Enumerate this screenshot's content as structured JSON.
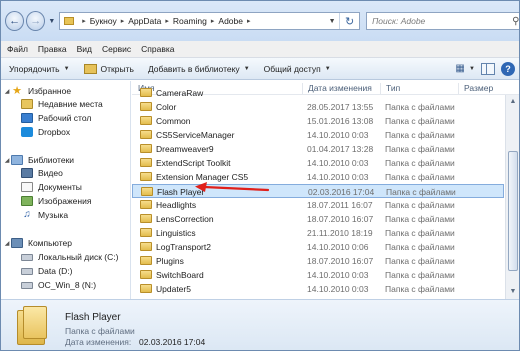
{
  "address": {
    "breadcrumbs": [
      "Букноу",
      "AppData",
      "Roaming",
      "Adobe"
    ]
  },
  "search": {
    "placeholder": "Поиск: Adobe"
  },
  "menu": [
    "Файл",
    "Правка",
    "Вид",
    "Сервис",
    "Справка"
  ],
  "toolbar": {
    "organize": "Упорядочить",
    "open": "Открыть",
    "add_to_library": "Добавить в библиотеку",
    "share": "Общий доступ"
  },
  "columns": {
    "name": "Имя",
    "date": "Дата изменения",
    "type": "Тип",
    "size": "Размер"
  },
  "nav": {
    "favorites": "Избранное",
    "recent": "Недавние места",
    "desktop": "Рабочий стол",
    "dropbox": "Dropbox",
    "libraries": "Библиотеки",
    "video": "Видео",
    "documents": "Документы",
    "images": "Изображения",
    "music": "Музыка",
    "computer": "Компьютер",
    "local_disk": "Локальный диск (C:)",
    "data_disk": "Data (D:)",
    "oc_win": "OC_Win_8 (N:)"
  },
  "files": [
    {
      "name": "CameraRaw",
      "date": "",
      "type": ""
    },
    {
      "name": "Color",
      "date": "28.05.2017 13:55",
      "type": "Папка с файлами"
    },
    {
      "name": "Common",
      "date": "15.01.2016 13:08",
      "type": "Папка с файлами"
    },
    {
      "name": "CS5ServiceManager",
      "date": "14.10.2010 0:03",
      "type": "Папка с файлами"
    },
    {
      "name": "Dreamweaver9",
      "date": "01.04.2017 13:28",
      "type": "Папка с файлами"
    },
    {
      "name": "ExtendScript Toolkit",
      "date": "14.10.2010 0:03",
      "type": "Папка с файлами"
    },
    {
      "name": "Extension Manager CS5",
      "date": "14.10.2010 0:03",
      "type": "Папка с файлами"
    },
    {
      "name": "Flash Player",
      "date": "02.03.2016 17:04",
      "type": "Папка с файлами"
    },
    {
      "name": "Headlights",
      "date": "18.07.2011 16:07",
      "type": "Папка с файлами"
    },
    {
      "name": "LensCorrection",
      "date": "18.07.2010 16:07",
      "type": "Папка с файлами"
    },
    {
      "name": "Linguistics",
      "date": "21.11.2010 18:19",
      "type": "Папка с файлами"
    },
    {
      "name": "LogTransport2",
      "date": "14.10.2010 0:06",
      "type": "Папка с файлами"
    },
    {
      "name": "Plugins",
      "date": "18.07.2010 16:07",
      "type": "Папка с файлами"
    },
    {
      "name": "SwitchBoard",
      "date": "14.10.2010 0:03",
      "type": "Папка с файлами"
    },
    {
      "name": "Updater5",
      "date": "14.10.2010 0:03",
      "type": "Папка с файлами"
    }
  ],
  "details": {
    "name": "Flash Player",
    "type": "Папка с файлами",
    "date_label": "Дата изменения:",
    "date_value": "02.03.2016 17:04"
  }
}
